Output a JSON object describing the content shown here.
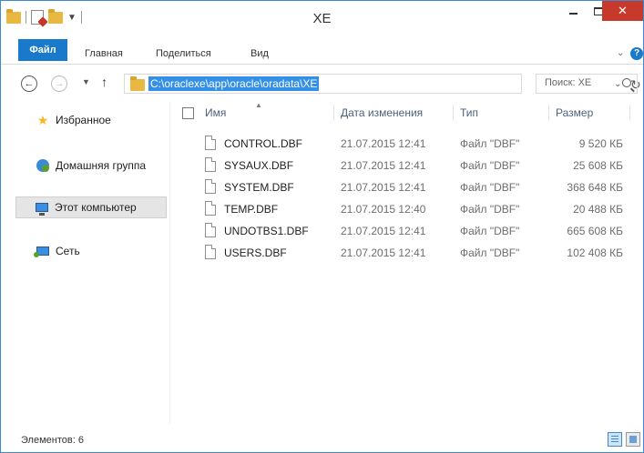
{
  "window": {
    "title": "XE",
    "close_label": "✕"
  },
  "ribbon": {
    "tabs": [
      "Файл",
      "Главная",
      "Поделиться",
      "Вид"
    ],
    "help_label": "?"
  },
  "address": {
    "path": "C:\\oraclexe\\app\\oracle\\oradata\\XE"
  },
  "search": {
    "placeholder": "Поиск: XE"
  },
  "nav_pane": {
    "items": [
      {
        "label": "Избранное",
        "icon": "star-icon"
      },
      {
        "label": "Домашняя группа",
        "icon": "homegroup-icon"
      },
      {
        "label": "Этот компьютер",
        "icon": "computer-icon"
      },
      {
        "label": "Сеть",
        "icon": "network-icon"
      }
    ]
  },
  "columns": {
    "name": "Имя",
    "date": "Дата изменения",
    "type": "Тип",
    "size": "Размер"
  },
  "files": [
    {
      "name": "CONTROL.DBF",
      "date": "21.07.2015 12:41",
      "type": "Файл \"DBF\"",
      "size": "9 520 КБ"
    },
    {
      "name": "SYSAUX.DBF",
      "date": "21.07.2015 12:41",
      "type": "Файл \"DBF\"",
      "size": "25 608 КБ"
    },
    {
      "name": "SYSTEM.DBF",
      "date": "21.07.2015 12:41",
      "type": "Файл \"DBF\"",
      "size": "368 648 КБ"
    },
    {
      "name": "TEMP.DBF",
      "date": "21.07.2015 12:40",
      "type": "Файл \"DBF\"",
      "size": "20 488 КБ"
    },
    {
      "name": "UNDOTBS1.DBF",
      "date": "21.07.2015 12:41",
      "type": "Файл \"DBF\"",
      "size": "665 608 КБ"
    },
    {
      "name": "USERS.DBF",
      "date": "21.07.2015 12:41",
      "type": "Файл \"DBF\"",
      "size": "102 408 КБ"
    }
  ],
  "status": {
    "text": "Элементов: 6"
  },
  "colors": {
    "accent": "#1979ca",
    "close": "#c7392b",
    "selection": "#3390e6"
  }
}
